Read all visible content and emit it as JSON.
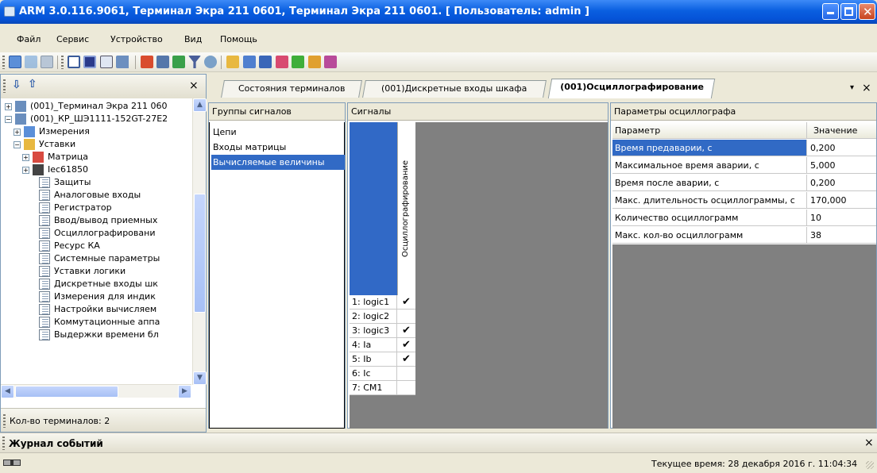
{
  "window": {
    "title": "ARM 3.0.116.9061, Терминал Экра 211 0601, Терминал Экра 211 0601. [ Пользователь: admin ]"
  },
  "menu": [
    "Файл",
    "Сервис",
    "Устройство",
    "Вид",
    "Помощь"
  ],
  "toolbar_icons": [
    "users-icon",
    "user-group-icon",
    "panel-icon",
    "list-icon",
    "screen-icon",
    "grid-icon",
    "window-dropdown-icon",
    "chart-icon",
    "data-icon",
    "network-icon",
    "filter-icon",
    "settings-icon",
    "folder-icon",
    "edit-icon",
    "save-icon",
    "image-icon",
    "refresh-icon",
    "bug-icon",
    "flag-icon"
  ],
  "left_panel": {
    "close": "×",
    "tree": [
      {
        "label": "(001)_Терминал Экра 211 060",
        "expander": "+",
        "icon": "terminal-icon"
      },
      {
        "label": "(001)_КР_ШЭ1111-152GT-27E2",
        "expander": "−",
        "icon": "terminal-icon"
      },
      {
        "label": "Измерения",
        "expander": "+",
        "icon": "measure-icon"
      },
      {
        "label": "Уставки",
        "expander": "−",
        "icon": "folder-icon"
      },
      {
        "label": "Матрица",
        "expander": "+",
        "icon": "matrix-icon"
      },
      {
        "label": "Iec61850",
        "expander": "+",
        "icon": "iec-icon"
      },
      {
        "label": "Защиты",
        "icon": "doc-icon"
      },
      {
        "label": "Аналоговые входы",
        "icon": "doc-icon"
      },
      {
        "label": "Регистратор",
        "icon": "doc-icon"
      },
      {
        "label": "Ввод/вывод приемных",
        "icon": "doc-icon"
      },
      {
        "label": "Осциллографировани",
        "icon": "doc-icon"
      },
      {
        "label": "Ресурс КА",
        "icon": "doc-icon"
      },
      {
        "label": "Системные параметры",
        "icon": "doc-icon"
      },
      {
        "label": "Уставки логики",
        "icon": "doc-icon"
      },
      {
        "label": "Дискретные входы шк",
        "icon": "doc-icon"
      },
      {
        "label": "Измерения для индик",
        "icon": "gauge-icon"
      },
      {
        "label": "Настройки вычисляем",
        "icon": "doc-icon"
      },
      {
        "label": "Коммутационные аппа",
        "icon": "doc-icon"
      },
      {
        "label": "Выдержки времени бл",
        "icon": "doc-icon"
      }
    ],
    "terminal_count": "Кол-во терминалов: 2"
  },
  "tabs": {
    "items": [
      "Состояния терминалов",
      "(001)Дискретные входы шкафа",
      "(001)Осциллографирование"
    ],
    "active": 2,
    "dropdown": "▾",
    "close": "×"
  },
  "groups": {
    "header": "Группы сигналов",
    "items": [
      "Цепи",
      "Входы матрицы",
      "Вычисляемые величины"
    ],
    "selected": 2
  },
  "signals": {
    "header": "Сигналы",
    "column": "Осциллографирование",
    "rows": [
      {
        "label": "1: logic1",
        "checked": true
      },
      {
        "label": "2: logic2",
        "checked": false
      },
      {
        "label": "3: logic3",
        "checked": true
      },
      {
        "label": "4: Ia",
        "checked": true
      },
      {
        "label": "5: Ib",
        "checked": true
      },
      {
        "label": "6: Ic",
        "checked": false
      },
      {
        "label": "7: CM1",
        "checked": false
      }
    ]
  },
  "params": {
    "header": "Параметры осциллографа",
    "col_param": "Параметр",
    "col_value": "Значение",
    "rows": [
      {
        "name": "Время предаварии, с",
        "value": "0,200"
      },
      {
        "name": "Максимальное время аварии, с",
        "value": "5,000"
      },
      {
        "name": "Время после аварии, с",
        "value": "0,200"
      },
      {
        "name": "Макс. длительность осциллограммы, с",
        "value": "170,000"
      },
      {
        "name": "Количество осциллограмм",
        "value": "10"
      },
      {
        "name": "Макс. кол-во осциллограмм",
        "value": "38"
      }
    ],
    "selected": 0
  },
  "journal": {
    "title": "Журнал событий",
    "close": "×"
  },
  "status": {
    "time": "Текущее время: 28 декабря 2016 г. 11:04:34"
  }
}
